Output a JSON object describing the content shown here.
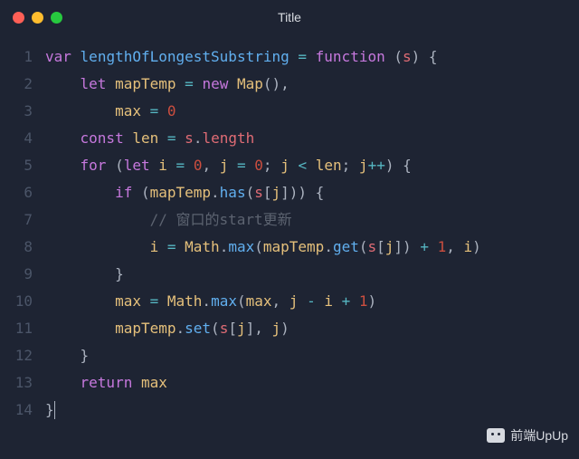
{
  "window": {
    "title": "Title"
  },
  "lights": {
    "close": "red",
    "minimize": "yellow",
    "zoom": "green"
  },
  "watermark": {
    "text": "前端UpUp"
  },
  "code": {
    "lines": [
      {
        "n": "1",
        "tokens": [
          [
            "kw",
            "var"
          ],
          [
            "punct",
            " "
          ],
          [
            "fn-def",
            "lengthOfLongestSubstring"
          ],
          [
            "punct",
            " "
          ],
          [
            "op",
            "="
          ],
          [
            "punct",
            " "
          ],
          [
            "fn-kw",
            "function"
          ],
          [
            "punct",
            " ("
          ],
          [
            "param",
            "s"
          ],
          [
            "punct",
            ") {"
          ]
        ]
      },
      {
        "n": "2",
        "tokens": [
          [
            "punct",
            "    "
          ],
          [
            "kw",
            "let"
          ],
          [
            "punct",
            " "
          ],
          [
            "varname",
            "mapTemp"
          ],
          [
            "punct",
            " "
          ],
          [
            "op",
            "="
          ],
          [
            "punct",
            " "
          ],
          [
            "kw",
            "new"
          ],
          [
            "punct",
            " "
          ],
          [
            "cls",
            "Map"
          ],
          [
            "punct",
            "(),"
          ]
        ]
      },
      {
        "n": "3",
        "tokens": [
          [
            "punct",
            "        "
          ],
          [
            "varname",
            "max"
          ],
          [
            "punct",
            " "
          ],
          [
            "op",
            "="
          ],
          [
            "punct",
            " "
          ],
          [
            "num1",
            "0"
          ]
        ]
      },
      {
        "n": "4",
        "tokens": [
          [
            "punct",
            "    "
          ],
          [
            "kw",
            "const"
          ],
          [
            "punct",
            " "
          ],
          [
            "varname",
            "len"
          ],
          [
            "punct",
            " "
          ],
          [
            "op",
            "="
          ],
          [
            "punct",
            " "
          ],
          [
            "param",
            "s"
          ],
          [
            "punct",
            "."
          ],
          [
            "prop",
            "length"
          ]
        ]
      },
      {
        "n": "5",
        "tokens": [
          [
            "punct",
            "    "
          ],
          [
            "kw",
            "for"
          ],
          [
            "punct",
            " ("
          ],
          [
            "kw",
            "let"
          ],
          [
            "punct",
            " "
          ],
          [
            "varname",
            "i"
          ],
          [
            "punct",
            " "
          ],
          [
            "op",
            "="
          ],
          [
            "punct",
            " "
          ],
          [
            "num1",
            "0"
          ],
          [
            "punct",
            ", "
          ],
          [
            "varname",
            "j"
          ],
          [
            "punct",
            " "
          ],
          [
            "op",
            "="
          ],
          [
            "punct",
            " "
          ],
          [
            "num1",
            "0"
          ],
          [
            "punct",
            "; "
          ],
          [
            "varname",
            "j"
          ],
          [
            "punct",
            " "
          ],
          [
            "op",
            "<"
          ],
          [
            "punct",
            " "
          ],
          [
            "varname",
            "len"
          ],
          [
            "punct",
            "; "
          ],
          [
            "varname",
            "j"
          ],
          [
            "op",
            "++"
          ],
          [
            "punct",
            ") {"
          ]
        ]
      },
      {
        "n": "6",
        "tokens": [
          [
            "punct",
            "        "
          ],
          [
            "kw",
            "if"
          ],
          [
            "punct",
            " ("
          ],
          [
            "varname",
            "mapTemp"
          ],
          [
            "punct",
            "."
          ],
          [
            "method",
            "has"
          ],
          [
            "punct",
            "("
          ],
          [
            "param",
            "s"
          ],
          [
            "punct",
            "["
          ],
          [
            "varname",
            "j"
          ],
          [
            "punct",
            "])) {"
          ]
        ]
      },
      {
        "n": "7",
        "tokens": [
          [
            "punct",
            "            "
          ],
          [
            "comment",
            "// 窗口的start更新"
          ]
        ]
      },
      {
        "n": "8",
        "tokens": [
          [
            "punct",
            "            "
          ],
          [
            "varname",
            "i"
          ],
          [
            "punct",
            " "
          ],
          [
            "op",
            "="
          ],
          [
            "punct",
            " "
          ],
          [
            "cls",
            "Math"
          ],
          [
            "punct",
            "."
          ],
          [
            "method",
            "max"
          ],
          [
            "punct",
            "("
          ],
          [
            "varname",
            "mapTemp"
          ],
          [
            "punct",
            "."
          ],
          [
            "method",
            "get"
          ],
          [
            "punct",
            "("
          ],
          [
            "param",
            "s"
          ],
          [
            "punct",
            "["
          ],
          [
            "varname",
            "j"
          ],
          [
            "punct",
            "]) "
          ],
          [
            "op",
            "+"
          ],
          [
            "punct",
            " "
          ],
          [
            "num1",
            "1"
          ],
          [
            "punct",
            ", "
          ],
          [
            "varname",
            "i"
          ],
          [
            "punct",
            ")"
          ]
        ]
      },
      {
        "n": "9",
        "tokens": [
          [
            "punct",
            "        }"
          ]
        ]
      },
      {
        "n": "10",
        "tokens": [
          [
            "punct",
            "        "
          ],
          [
            "varname",
            "max"
          ],
          [
            "punct",
            " "
          ],
          [
            "op",
            "="
          ],
          [
            "punct",
            " "
          ],
          [
            "cls",
            "Math"
          ],
          [
            "punct",
            "."
          ],
          [
            "method",
            "max"
          ],
          [
            "punct",
            "("
          ],
          [
            "varname",
            "max"
          ],
          [
            "punct",
            ", "
          ],
          [
            "varname",
            "j"
          ],
          [
            "punct",
            " "
          ],
          [
            "op",
            "-"
          ],
          [
            "punct",
            " "
          ],
          [
            "varname",
            "i"
          ],
          [
            "punct",
            " "
          ],
          [
            "op",
            "+"
          ],
          [
            "punct",
            " "
          ],
          [
            "num1",
            "1"
          ],
          [
            "punct",
            ")"
          ]
        ]
      },
      {
        "n": "11",
        "tokens": [
          [
            "punct",
            "        "
          ],
          [
            "varname",
            "mapTemp"
          ],
          [
            "punct",
            "."
          ],
          [
            "method",
            "set"
          ],
          [
            "punct",
            "("
          ],
          [
            "param",
            "s"
          ],
          [
            "punct",
            "["
          ],
          [
            "varname",
            "j"
          ],
          [
            "punct",
            "], "
          ],
          [
            "varname",
            "j"
          ],
          [
            "punct",
            ")"
          ]
        ]
      },
      {
        "n": "12",
        "tokens": [
          [
            "punct",
            "    }"
          ]
        ]
      },
      {
        "n": "13",
        "tokens": [
          [
            "punct",
            "    "
          ],
          [
            "kw",
            "return"
          ],
          [
            "punct",
            " "
          ],
          [
            "varname",
            "max"
          ]
        ]
      },
      {
        "n": "14",
        "tokens": [
          [
            "punct",
            "}"
          ],
          [
            "cursor",
            ""
          ]
        ]
      }
    ]
  }
}
